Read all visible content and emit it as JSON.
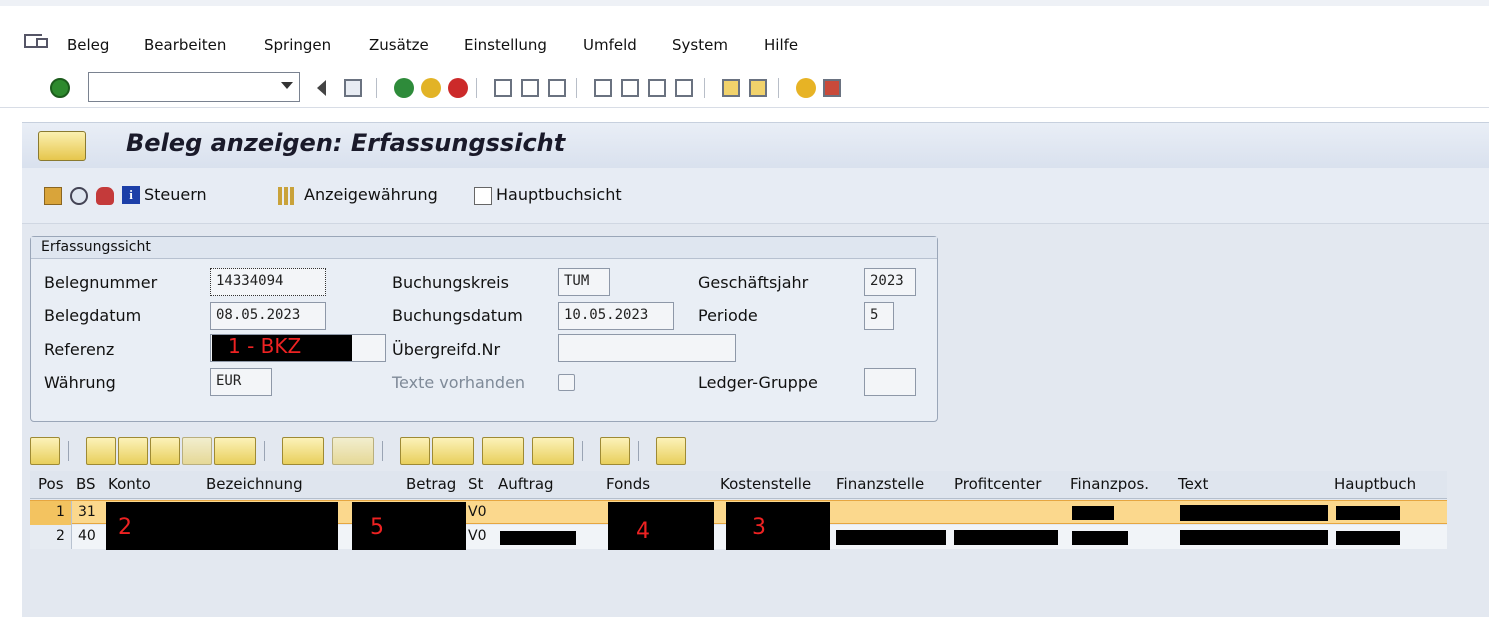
{
  "menu": {
    "items": [
      "Beleg",
      "Bearbeiten",
      "Springen",
      "Zusätze",
      "Einstellung",
      "Umfeld",
      "System",
      "Hilfe"
    ]
  },
  "toolbar": {
    "command_value": ""
  },
  "title": "Beleg anzeigen: Erfassungssicht",
  "app_toolbar": {
    "steuern": "Steuern",
    "anzeigewaehrung": "Anzeigewährung",
    "hauptbuchsicht": "Hauptbuchsicht"
  },
  "group": {
    "title": "Erfassungssicht",
    "belegnummer_label": "Belegnummer",
    "belegnummer": "14334094",
    "belegdatum_label": "Belegdatum",
    "belegdatum": "08.05.2023",
    "referenz_label": "Referenz",
    "referenz_annotation": "1 - BKZ",
    "waehrung_label": "Währung",
    "waehrung": "EUR",
    "buchungskreis_label": "Buchungskreis",
    "buchungskreis": "TUM",
    "buchungsdatum_label": "Buchungsdatum",
    "buchungsdatum": "10.05.2023",
    "uebergreifd_label": "Übergreifd.Nr",
    "uebergreifd": "",
    "texte_label": "Texte vorhanden",
    "geschaeftsjahr_label": "Geschäftsjahr",
    "geschaeftsjahr": "2023",
    "periode_label": "Periode",
    "periode": "5",
    "ledger_label": "Ledger-Gruppe",
    "ledger": ""
  },
  "grid": {
    "headers": {
      "pos": "Pos",
      "bs": "BS",
      "konto": "Konto",
      "bezeichnung": "Bezeichnung",
      "betrag": "Betrag",
      "st": "St",
      "auftrag": "Auftrag",
      "fonds": "Fonds",
      "kostenstelle": "Kostenstelle",
      "finanzstelle": "Finanzstelle",
      "profitcenter": "Profitcenter",
      "finanzpos": "Finanzpos.",
      "text": "Text",
      "hauptbuch": "Hauptbuch"
    },
    "rows": [
      {
        "pos": "1",
        "bs": "31",
        "st": "V0"
      },
      {
        "pos": "2",
        "bs": "40",
        "st": "V0"
      }
    ],
    "annotations": {
      "konto": "2",
      "betrag": "5",
      "fonds": "4",
      "kostenstelle": "3"
    }
  },
  "colors": {
    "selected_row": "#fbd88d",
    "annotation": "#e22222",
    "redaction": "#000000"
  }
}
